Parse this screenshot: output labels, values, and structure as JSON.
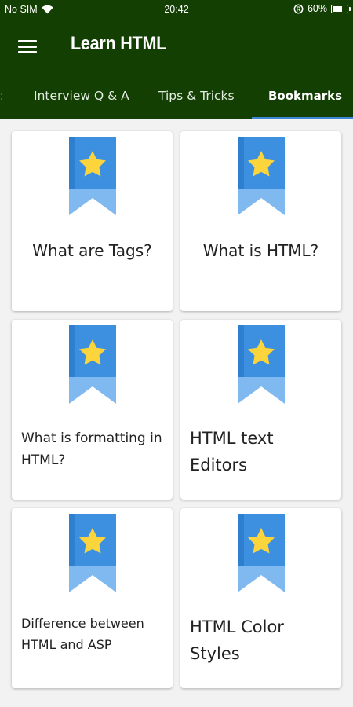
{
  "status": {
    "carrier": "No SIM",
    "time": "20:42",
    "battery": "60%",
    "battery_level": 0.6
  },
  "app_bar": {
    "title": "Learn HTML"
  },
  "tabs": [
    {
      "label": "Interview Q & A",
      "active": false
    },
    {
      "label": "Tips & Tricks",
      "active": false
    },
    {
      "label": "Bookmarks",
      "active": true
    }
  ],
  "colors": {
    "primary": "#133f03",
    "accent": "#3d86d8",
    "bookmark_light": "#7fb9ef",
    "bookmark_dark": "#2f7fd0",
    "star": "#fcd43c"
  },
  "bookmarks": [
    {
      "title": "What are Tags?",
      "icon": "bookmark-star-icon"
    },
    {
      "title": "What is HTML?",
      "icon": "bookmark-star-icon"
    },
    {
      "title": "What is formatting in HTML?",
      "icon": "bookmark-star-icon"
    },
    {
      "title": "HTML text Editors",
      "icon": "bookmark-star-icon"
    },
    {
      "title": "Difference between HTML and ASP",
      "icon": "bookmark-star-icon"
    },
    {
      "title": "HTML Color Styles",
      "icon": "bookmark-star-icon"
    }
  ]
}
